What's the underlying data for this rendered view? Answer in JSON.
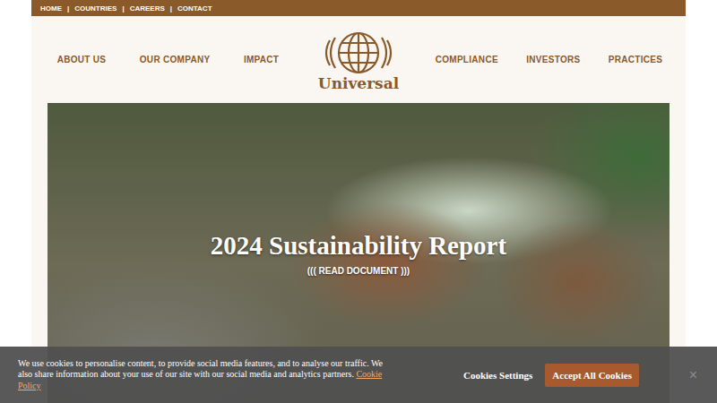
{
  "top_links": [
    "HOME",
    "COUNTRIES",
    "CAREERS",
    "CONTACT"
  ],
  "separator": "|",
  "nav_left": [
    "ABOUT US",
    "OUR COMPANY",
    "IMPACT"
  ],
  "logo": {
    "text": "Universal"
  },
  "nav_right": [
    "COMPLIANCE",
    "INVESTORS",
    "PRACTICES"
  ],
  "hero": {
    "title": "2024 Sustainability Report",
    "link": "((( READ DOCUMENT )))"
  },
  "cookie_banner": {
    "text": "We use cookies to personalise content, to provide social media features, and to analyse our traffic. We also share information about your use of our site with our social media and analytics partners.",
    "policy_link": "Cookie Policy",
    "settings_button": "Cookies Settings",
    "accept_button": "Accept All Cookies",
    "close": "×"
  }
}
